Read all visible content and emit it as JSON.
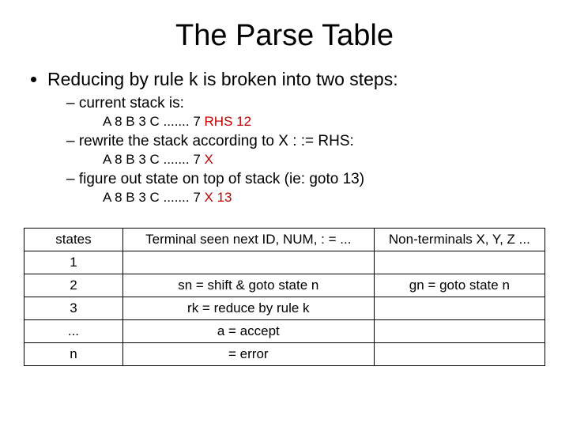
{
  "title": "The Parse Table",
  "bullet": "Reducing by rule k is broken into two steps:",
  "sub1": "current stack is:",
  "stack1_a": "A 8 B 3 C  ....... 7 ",
  "stack1_b": "RHS 12",
  "sub2": "rewrite the stack according to X : := RHS:",
  "stack2_a": "A 8 B 3 C  ....... 7 ",
  "stack2_b": "X",
  "sub3": "figure out state on top of stack (ie: goto 13)",
  "stack3_a": "A 8 B 3 C  ....... 7 ",
  "stack3_b": "X 13",
  "table": {
    "headers": {
      "c0": "states",
      "c1": "Terminal seen next ID, NUM, : = ...",
      "c2": "Non-terminals X, Y, Z ..."
    },
    "rows": [
      {
        "c0": "1",
        "c1": "",
        "c2": ""
      },
      {
        "c0": "2",
        "c1": "sn = shift & goto state n",
        "c2": "gn = goto state n"
      },
      {
        "c0": "3",
        "c1": "rk = reduce by rule k",
        "c2": ""
      },
      {
        "c0": "...",
        "c1": "a = accept",
        "c2": ""
      },
      {
        "c0": "n",
        "c1": "  = error",
        "c2": ""
      }
    ]
  }
}
